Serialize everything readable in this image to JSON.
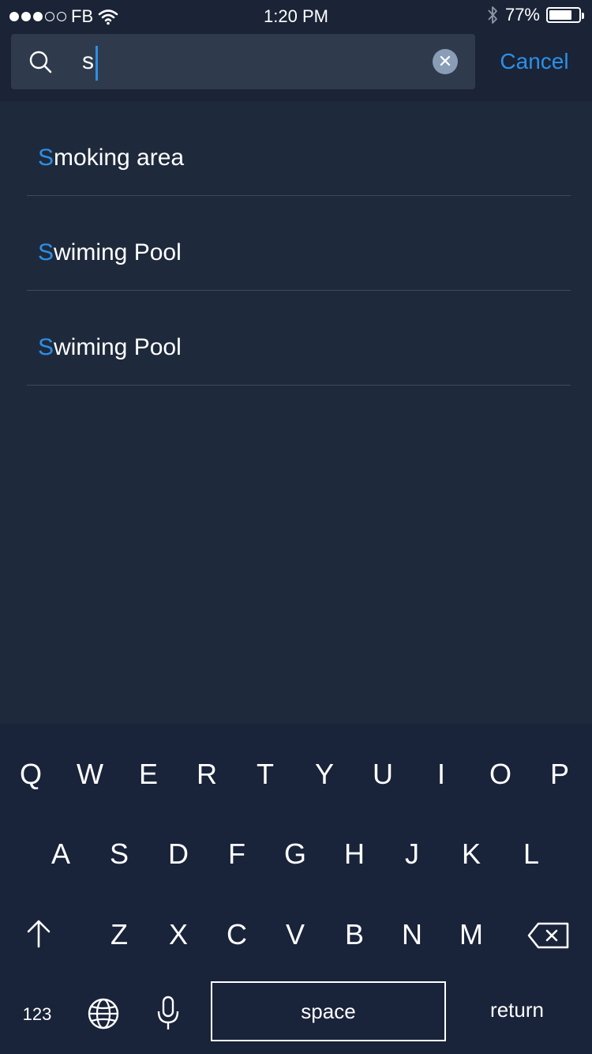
{
  "status_bar": {
    "carrier": "FB",
    "time": "1:20 PM",
    "battery_percent": "77%",
    "battery_level": 0.77,
    "signal_bars_filled": 3,
    "signal_bars_total": 5
  },
  "search": {
    "query": "s",
    "clear_icon": "close-icon",
    "cancel_label": "Cancel"
  },
  "results": [
    {
      "highlight": "S",
      "rest": "moking area"
    },
    {
      "highlight": "S",
      "rest": "wiming Pool"
    },
    {
      "highlight": "S",
      "rest": "wiming Pool"
    }
  ],
  "keyboard": {
    "row1": [
      "Q",
      "W",
      "E",
      "R",
      "T",
      "Y",
      "U",
      "I",
      "O",
      "P"
    ],
    "row2": [
      "A",
      "S",
      "D",
      "F",
      "G",
      "H",
      "J",
      "K",
      "L"
    ],
    "row3": [
      "Z",
      "X",
      "C",
      "V",
      "B",
      "N",
      "M"
    ],
    "numbers_label": "123",
    "space_label": "space",
    "return_label": "return"
  },
  "colors": {
    "accent": "#2e8fe8",
    "background": "#1e2a3c",
    "header": "#1a2436",
    "keyboard": "#19233a"
  }
}
